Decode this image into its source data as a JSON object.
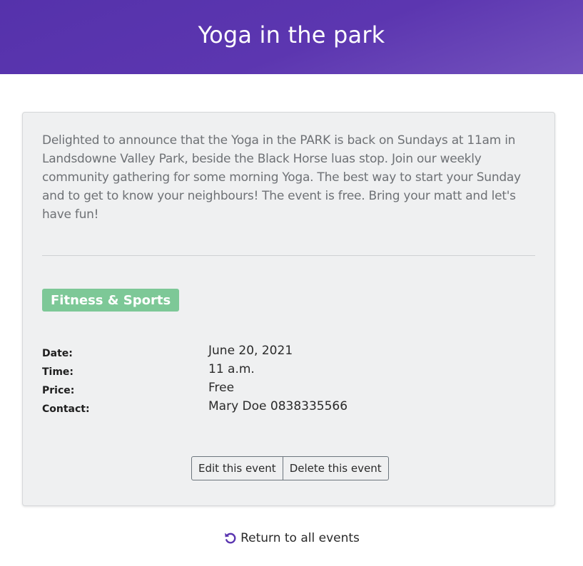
{
  "header": {
    "title": "Yoga in the park"
  },
  "event": {
    "description": "Delighted to announce that the Yoga in the PARK is back on Sundays at 11am in Landsdowne Valley Park, beside the Black Horse luas stop. Join our weekly community gathering for some morning Yoga. The best way to start your Sunday and to get to know your neighbours! The event is free. Bring your matt and let's have fun!",
    "category": "Fitness & Sports",
    "details": [
      {
        "label": "Date:",
        "value": "June 20, 2021"
      },
      {
        "label": "Time:",
        "value": "11 a.m."
      },
      {
        "label": "Price:",
        "value": "Free"
      },
      {
        "label": "Contact:",
        "value": "Mary Doe 0838335566"
      }
    ]
  },
  "actions": {
    "edit_label": "Edit this event",
    "delete_label": "Delete this event"
  },
  "footer": {
    "return_label": "Return to all events",
    "return_icon": "undo-icon"
  },
  "colors": {
    "header": "#5532ab",
    "badge": "#7dc897",
    "card": "#eff0f1",
    "accent_icon": "#5a35b0"
  }
}
